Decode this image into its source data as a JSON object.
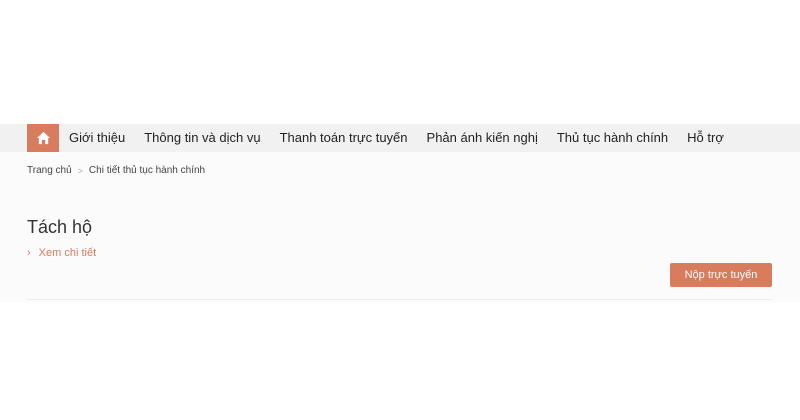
{
  "nav": {
    "home_icon": "home-icon",
    "items": [
      {
        "label": "Giới thiệu"
      },
      {
        "label": "Thông tin và dịch vụ"
      },
      {
        "label": "Thanh toán trực tuyến"
      },
      {
        "label": "Phản ánh kiến nghị"
      },
      {
        "label": "Thủ tục hành chính"
      },
      {
        "label": "Hỗ trợ"
      }
    ]
  },
  "breadcrumb": {
    "home": "Trang chủ",
    "separator": ">",
    "current": "Chi tiết thủ tục hành chính"
  },
  "procedure": {
    "title": "Tách hộ",
    "detail_link": "Xem chi tiết",
    "submit_label": "Nộp trực tuyến"
  },
  "colors": {
    "accent": "#d97c5e",
    "nav_background": "#f1f1f1"
  }
}
